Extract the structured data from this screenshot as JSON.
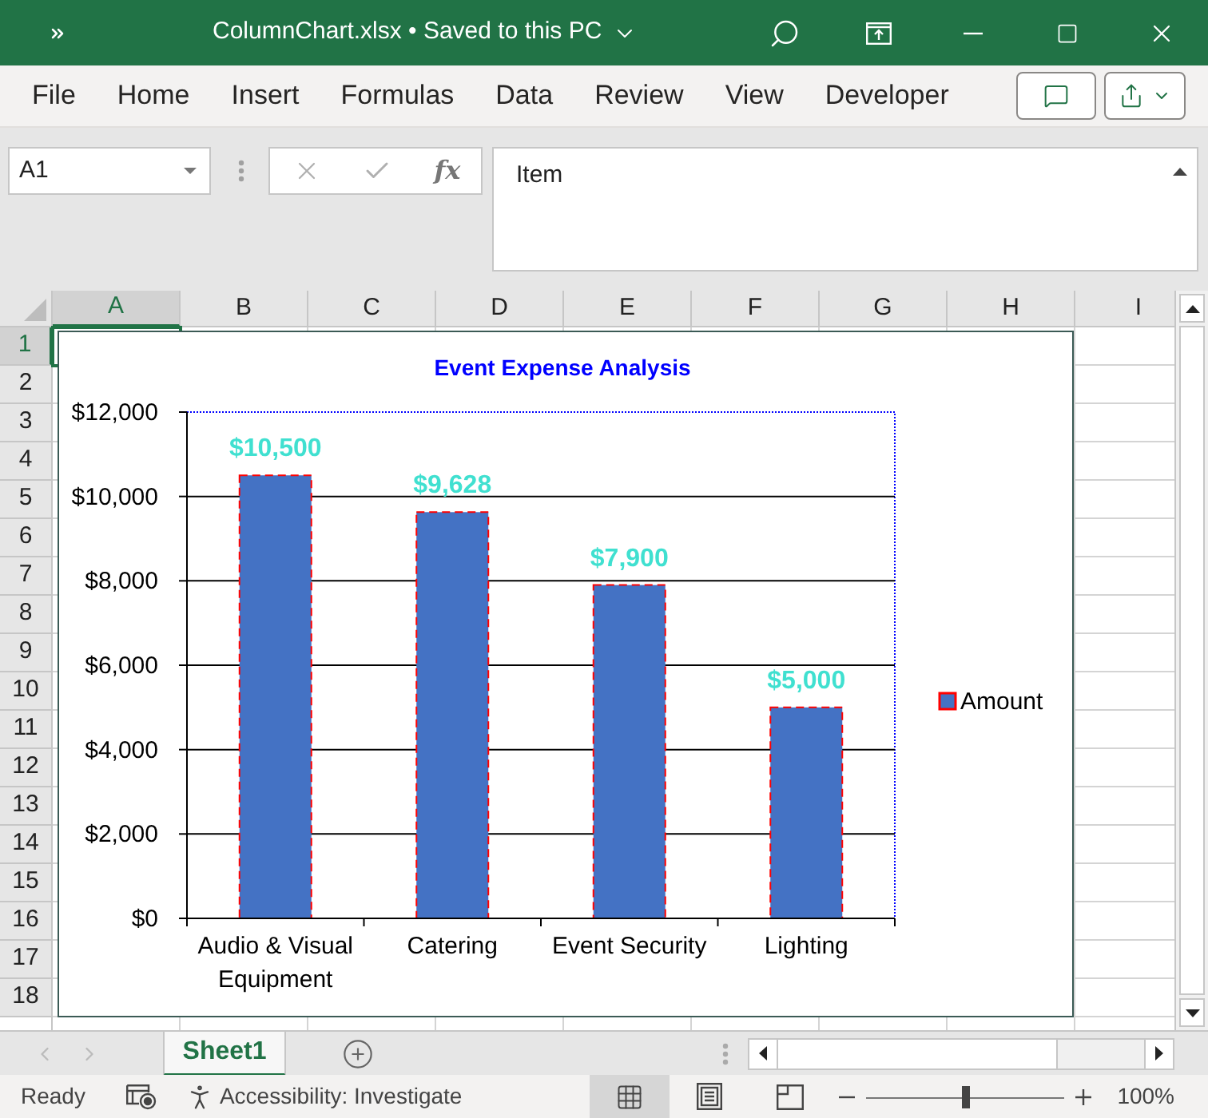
{
  "window": {
    "title": "ColumnChart.xlsx • Saved to this PC"
  },
  "ribbon_tabs": [
    {
      "label": "File"
    },
    {
      "label": "Home"
    },
    {
      "label": "Insert"
    },
    {
      "label": "Formulas"
    },
    {
      "label": "Data"
    },
    {
      "label": "Review"
    },
    {
      "label": "View"
    },
    {
      "label": "Developer"
    }
  ],
  "formula_bar": {
    "name_box": "A1",
    "function_label": "fx",
    "content": "Item"
  },
  "columns": [
    {
      "label": "A",
      "selected": true
    },
    {
      "label": "B",
      "selected": false
    },
    {
      "label": "C",
      "selected": false
    },
    {
      "label": "D",
      "selected": false
    },
    {
      "label": "E",
      "selected": false
    },
    {
      "label": "F",
      "selected": false
    },
    {
      "label": "G",
      "selected": false
    },
    {
      "label": "H",
      "selected": false
    },
    {
      "label": "I",
      "selected": false
    }
  ],
  "rows": [
    {
      "label": "1",
      "selected": true
    },
    {
      "label": "2",
      "selected": false
    },
    {
      "label": "3",
      "selected": false
    },
    {
      "label": "4",
      "selected": false
    },
    {
      "label": "5",
      "selected": false
    },
    {
      "label": "6",
      "selected": false
    },
    {
      "label": "7",
      "selected": false
    },
    {
      "label": "8",
      "selected": false
    },
    {
      "label": "9",
      "selected": false
    },
    {
      "label": "10",
      "selected": false
    },
    {
      "label": "11",
      "selected": false
    },
    {
      "label": "12",
      "selected": false
    },
    {
      "label": "13",
      "selected": false
    },
    {
      "label": "14",
      "selected": false
    },
    {
      "label": "15",
      "selected": false
    },
    {
      "label": "16",
      "selected": false
    },
    {
      "label": "17",
      "selected": false
    },
    {
      "label": "18",
      "selected": false
    }
  ],
  "chart": {
    "chart_data": {
      "type": "bar",
      "title": "Event Expense Analysis",
      "categories": [
        "Audio & Visual Equipment",
        "Catering",
        "Event Security",
        "Lighting"
      ],
      "series": [
        {
          "name": "Amount",
          "color": "#4472c4",
          "values": [
            10500,
            9628,
            7900,
            5000
          ]
        }
      ],
      "ylim": [
        0,
        12000
      ],
      "yticks": [
        {
          "value": 0,
          "label": "$0"
        },
        {
          "value": 2000,
          "label": "$2,000"
        },
        {
          "value": 4000,
          "label": "$4,000"
        },
        {
          "value": 6000,
          "label": "$6,000"
        },
        {
          "value": 8000,
          "label": "$8,000"
        },
        {
          "value": 10000,
          "label": "$10,000"
        },
        {
          "value": 12000,
          "label": "$12,000"
        }
      ],
      "grid": true,
      "value_labels": [
        "$10,500",
        "$9,628",
        "$7,900",
        "$5,000"
      ]
    }
  },
  "sheet_tabs": [
    {
      "label": "Sheet1",
      "selected": true
    }
  ],
  "status_bar": {
    "mode": "Ready",
    "accessibility": "Accessibility: Investigate",
    "views": [
      {
        "kind": "normal",
        "selected": true
      },
      {
        "kind": "page_layout",
        "selected": false
      },
      {
        "kind": "page_break",
        "selected": false
      }
    ],
    "zoom": {
      "level": 0.5,
      "reading": "100%"
    }
  }
}
